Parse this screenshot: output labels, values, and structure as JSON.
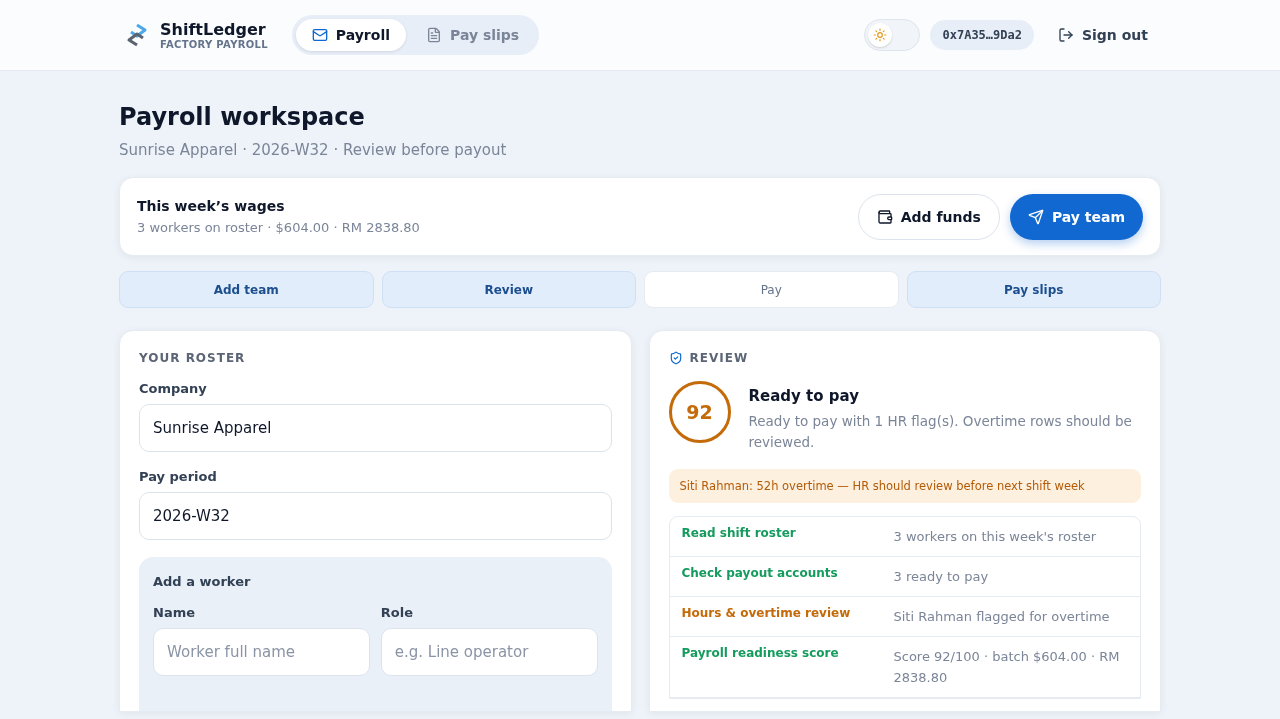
{
  "brand": {
    "name": "ShiftLedger",
    "tagline": "FACTORY PAYROLL"
  },
  "nav": [
    {
      "label": "Payroll",
      "selected": true
    },
    {
      "label": "Pay slips",
      "selected": false
    }
  ],
  "theme_toggle": {
    "on": false
  },
  "wallet": "0x7A35…9Da2",
  "sign_out": "Sign out",
  "page": {
    "title": "Payroll workspace",
    "subtitle": "Sunrise Apparel · 2026-W32 · Review before payout"
  },
  "summary": {
    "title": "This week’s wages",
    "detail": "3 workers on roster · $604.00 · RM 2838.80",
    "buttons": [
      {
        "label": "Add funds",
        "kind": "secondary"
      },
      {
        "label": "Pay team",
        "kind": "primary"
      }
    ]
  },
  "steps": [
    {
      "label": "Add team",
      "done": true
    },
    {
      "label": "Review",
      "done": true
    },
    {
      "label": "Pay",
      "done": false
    },
    {
      "label": "Pay slips",
      "done": true
    }
  ],
  "roster": {
    "heading": "YOUR ROSTER",
    "fields": [
      {
        "label": "Company",
        "value": "Sunrise Apparel"
      },
      {
        "label": "Pay period",
        "value": "2026-W32"
      }
    ],
    "add_worker": {
      "heading": "Add a worker",
      "fields": [
        {
          "label": "Name",
          "placeholder": "Worker full name"
        },
        {
          "label": "Role",
          "placeholder": "e.g. Line operator"
        }
      ]
    }
  },
  "review": {
    "heading": "REVIEW",
    "score": "92",
    "status": "Ready to pay",
    "message": "Ready to pay with 1 HR flag(s). Overtime rows should be reviewed.",
    "alert": "Siti Rahman: 52h overtime — HR should review before next shift week",
    "checks": [
      {
        "name": "Read shift roster",
        "result": "3 workers on this week's roster",
        "color": "#169b5e"
      },
      {
        "name": "Check payout accounts",
        "result": "3 ready to pay",
        "color": "#169b5e"
      },
      {
        "name": "Hours & overtime review",
        "result": "Siti Rahman flagged for overtime",
        "color": "#c46a08"
      },
      {
        "name": "Payroll readiness score",
        "result": "Score 92/100 · batch $604.00 · RM 2838.80",
        "color": "#169b5e"
      }
    ]
  }
}
